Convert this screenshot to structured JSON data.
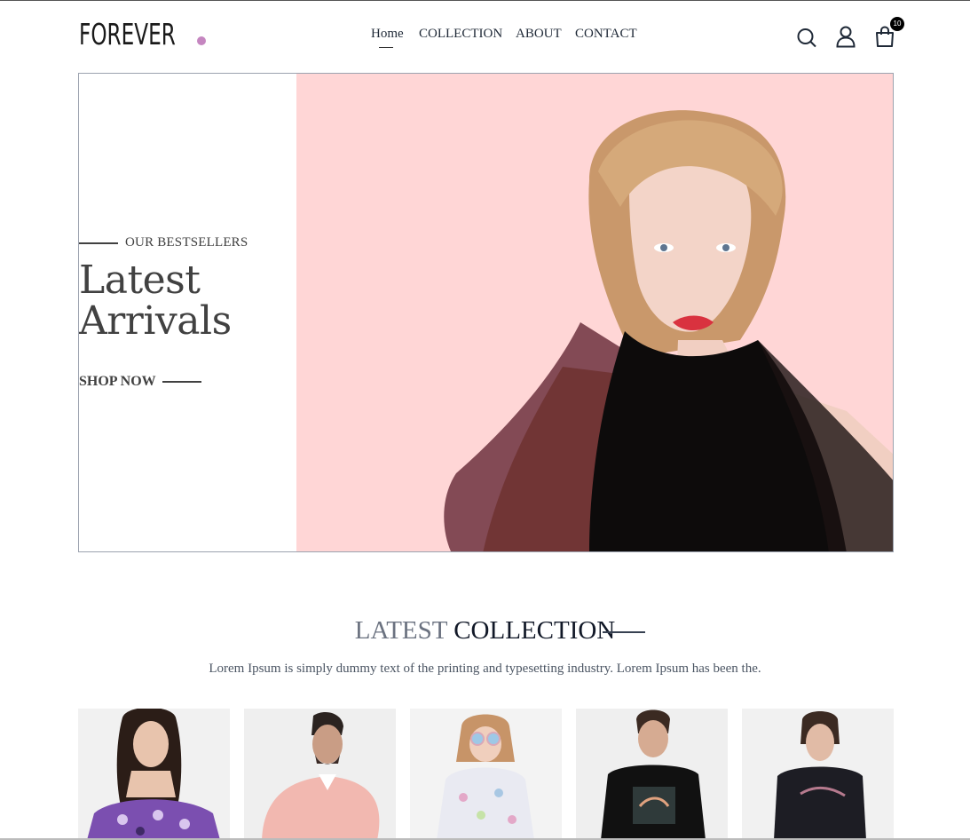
{
  "header": {
    "logo": "FOREVER",
    "logo_dot_color": "#c586c0",
    "nav": [
      {
        "label": "Home",
        "active": true
      },
      {
        "label": "COLLECTION",
        "active": false
      },
      {
        "label": "ABOUT",
        "active": false
      },
      {
        "label": "CONTACT",
        "active": false
      }
    ],
    "icons": [
      "search-icon",
      "profile-icon",
      "cart-icon"
    ],
    "cart_count": "10"
  },
  "hero": {
    "tag": "OUR BESTSELLERS",
    "headline_line1": "Latest",
    "headline_line2": "Arrivals",
    "cta": "SHOP NOW",
    "background_color": "#ffd6d6"
  },
  "latest_collection": {
    "title_light": "LATEST",
    "title_dark": "COLLECTION",
    "description": "Lorem Ipsum is simply dummy text of the printing and typesetting industry. Lorem Ipsum has been the."
  }
}
